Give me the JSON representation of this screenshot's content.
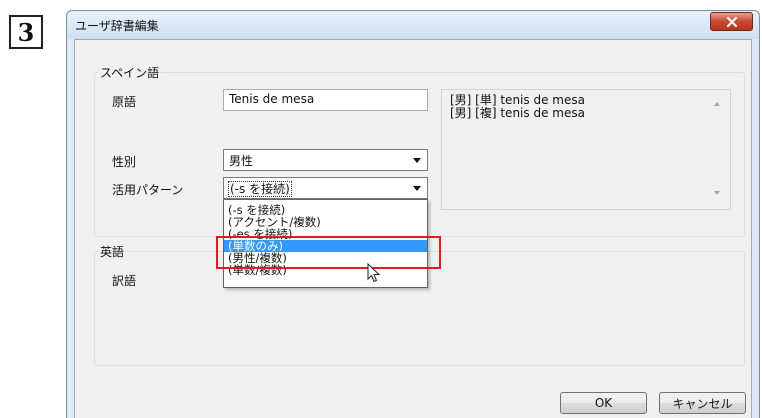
{
  "step_number": "3",
  "dialog": {
    "title": "ユーザ辞書編集",
    "close_icon": "close-x-icon"
  },
  "spanish_group": {
    "title": "スペイン語",
    "source_label": "原語",
    "source_value": "Tenis de mesa",
    "gender_label": "性別",
    "gender_value": "男性",
    "pattern_label": "活用パターン",
    "pattern_value": "(-s を接続)",
    "pattern_options": [
      "(-s を接続)",
      "(アクセント/複数)",
      "(-es を接続)",
      "(単数のみ)",
      "(男性/複数)",
      "(単数/複数)"
    ],
    "highlighted_option_index": 3,
    "preview_lines": [
      "[男] [単] tenis de mesa",
      "[男] [複] tenis de mesa"
    ]
  },
  "english_group": {
    "title": "英語",
    "translation_label": "訳語"
  },
  "buttons": {
    "ok": "OK",
    "cancel": "キャンセル"
  },
  "colors": {
    "highlight_border": "#e01b24",
    "selected_item": "#3399ff",
    "close_button": "#c84a32"
  }
}
